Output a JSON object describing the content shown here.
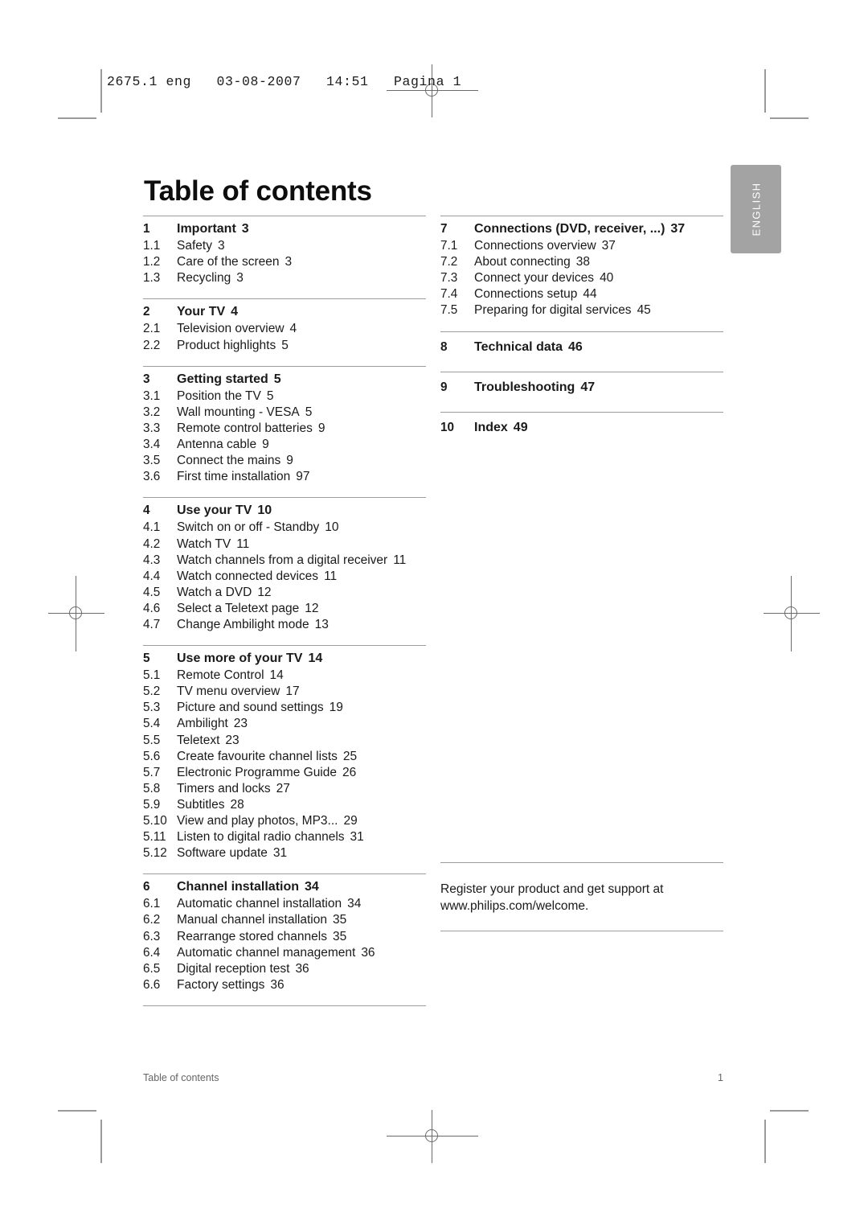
{
  "print_header": "2675.1 eng   03-08-2007   14:51   Pagina 1",
  "page_title": "Table of contents",
  "language_tab": "ENGLISH",
  "footer": {
    "left": "Table of contents",
    "page_number": "1"
  },
  "register_note": {
    "line1": "Register your product and get support at",
    "line2": "www.philips.com/welcome."
  },
  "left_column": [
    {
      "major": {
        "num": "1",
        "title": "Important",
        "page": "3"
      },
      "items": [
        {
          "num": "1.1",
          "title": "Safety",
          "page": "3"
        },
        {
          "num": "1.2",
          "title": "Care of the screen",
          "page": "3"
        },
        {
          "num": "1.3",
          "title": "Recycling",
          "page": "3"
        }
      ]
    },
    {
      "major": {
        "num": "2",
        "title": "Your TV",
        "page": "4"
      },
      "items": [
        {
          "num": "2.1",
          "title": "Television overview",
          "page": "4"
        },
        {
          "num": "2.2",
          "title": "Product highlights",
          "page": "5"
        }
      ]
    },
    {
      "major": {
        "num": "3",
        "title": "Getting started",
        "page": "5"
      },
      "items": [
        {
          "num": "3.1",
          "title": "Position the TV",
          "page": "5"
        },
        {
          "num": "3.2",
          "title": "Wall mounting - VESA",
          "page": "5"
        },
        {
          "num": "3.3",
          "title": "Remote control batteries",
          "page": "9"
        },
        {
          "num": "3.4",
          "title": "Antenna cable",
          "page": "9"
        },
        {
          "num": "3.5",
          "title": "Connect the mains",
          "page": "9"
        },
        {
          "num": "3.6",
          "title": "First time installation",
          "page": "97"
        }
      ]
    },
    {
      "major": {
        "num": "4",
        "title": "Use your TV",
        "page": "10"
      },
      "items": [
        {
          "num": "4.1",
          "title": "Switch on or off - Standby",
          "page": "10"
        },
        {
          "num": "4.2",
          "title": "Watch TV",
          "page": "11"
        },
        {
          "num": "4.3",
          "title": "Watch channels from a digital receiver",
          "page": "11"
        },
        {
          "num": "4.4",
          "title": "Watch connected devices",
          "page": "11"
        },
        {
          "num": "4.5",
          "title": "Watch a DVD",
          "page": "12"
        },
        {
          "num": "4.6",
          "title": "Select a Teletext page",
          "page": "12"
        },
        {
          "num": "4.7",
          "title": "Change Ambilight mode",
          "page": "13"
        }
      ]
    },
    {
      "major": {
        "num": "5",
        "title": "Use more of your TV",
        "page": "14"
      },
      "items": [
        {
          "num": "5.1",
          "title": "Remote Control",
          "page": "14"
        },
        {
          "num": "5.2",
          "title": "TV menu overview",
          "page": "17"
        },
        {
          "num": "5.3",
          "title": "Picture and sound settings",
          "page": "19"
        },
        {
          "num": "5.4",
          "title": "Ambilight",
          "page": "23"
        },
        {
          "num": "5.5",
          "title": "Teletext",
          "page": "23"
        },
        {
          "num": "5.6",
          "title": "Create favourite channel lists",
          "page": "25"
        },
        {
          "num": "5.7",
          "title": "Electronic Programme Guide",
          "page": "26"
        },
        {
          "num": "5.8",
          "title": "Timers and locks",
          "page": "27"
        },
        {
          "num": "5.9",
          "title": "Subtitles",
          "page": "28"
        },
        {
          "num": "5.10",
          "title": "View and play photos, MP3...",
          "page": "29"
        },
        {
          "num": "5.11",
          "title": "Listen to digital radio channels",
          "page": "31"
        },
        {
          "num": "5.12",
          "title": "Software update",
          "page": "31"
        }
      ]
    },
    {
      "major": {
        "num": "6",
        "title": "Channel installation",
        "page": "34"
      },
      "items": [
        {
          "num": "6.1",
          "title": "Automatic channel installation",
          "page": "34"
        },
        {
          "num": "6.2",
          "title": "Manual channel installation",
          "page": "35"
        },
        {
          "num": "6.3",
          "title": "Rearrange stored channels",
          "page": "35"
        },
        {
          "num": "6.4",
          "title": "Automatic channel management",
          "page": "36"
        },
        {
          "num": "6.5",
          "title": "Digital reception test",
          "page": "36"
        },
        {
          "num": "6.6",
          "title": "Factory settings",
          "page": "36"
        }
      ]
    }
  ],
  "right_column": [
    {
      "major": {
        "num": "7",
        "title": "Connections (DVD, receiver, ...)",
        "page": "37"
      },
      "items": [
        {
          "num": "7.1",
          "title": "Connections overview",
          "page": "37"
        },
        {
          "num": "7.2",
          "title": "About connecting",
          "page": "38"
        },
        {
          "num": "7.3",
          "title": "Connect your devices",
          "page": "40"
        },
        {
          "num": "7.4",
          "title": "Connections setup",
          "page": "44"
        },
        {
          "num": "7.5",
          "title": "Preparing for digital services",
          "page": "45"
        }
      ]
    },
    {
      "major": {
        "num": "8",
        "title": "Technical data",
        "page": "46"
      },
      "items": []
    },
    {
      "major": {
        "num": "9",
        "title": "Troubleshooting",
        "page": "47"
      },
      "items": []
    },
    {
      "major": {
        "num": "10",
        "title": "Index",
        "page": "49"
      },
      "items": []
    }
  ]
}
